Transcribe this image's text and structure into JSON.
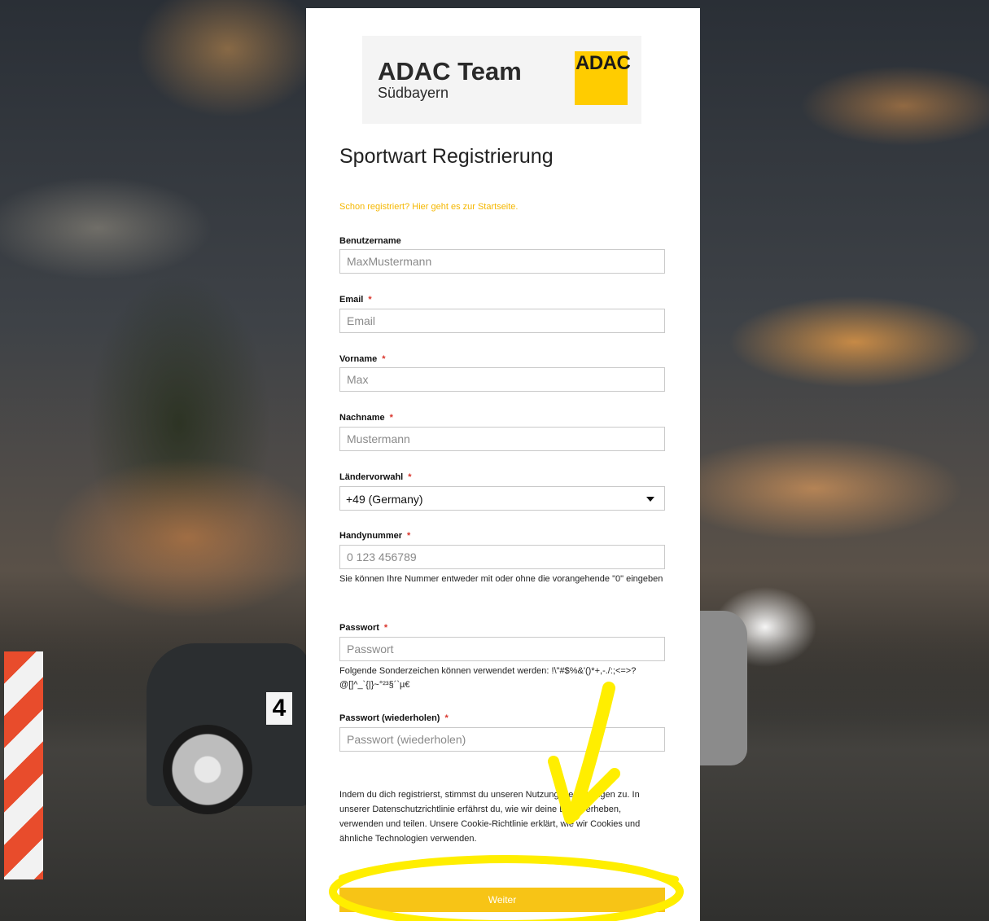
{
  "brand": {
    "title": "ADAC Team",
    "subtitle": "Südbayern",
    "logo_text": "ADAC"
  },
  "page_title": "Sportwart Registrierung",
  "login_link": "Schon registriert? Hier geht es zur Startseite.",
  "required_marker": "*",
  "fields": {
    "username": {
      "label": "Benutzername",
      "placeholder": "MaxMustermann"
    },
    "email": {
      "label": "Email",
      "placeholder": "Email"
    },
    "firstname": {
      "label": "Vorname",
      "placeholder": "Max"
    },
    "lastname": {
      "label": "Nachname",
      "placeholder": "Mustermann"
    },
    "country_code": {
      "label": "Ländervorwahl",
      "value": "+49 (Germany)"
    },
    "phone": {
      "label": "Handynummer",
      "placeholder": "0 123 456789",
      "hint": "Sie können Ihre Nummer entweder mit oder ohne die vorangehende \"0\" eingeben"
    },
    "password": {
      "label": "Passwort",
      "placeholder": "Passwort",
      "hint": "Folgende Sonderzeichen können verwendet werden: !\\\"#$%&'()*+,-./:;<=>?@[]^_`{|}~°²³§´`µ€"
    },
    "password_repeat": {
      "label": "Passwort (wiederholen)",
      "placeholder": "Passwort (wiederholen)"
    }
  },
  "terms_text": "Indem du dich registrierst, stimmst du unseren Nutzungsbedingungen zu. In unserer Datenschutzrichtlinie erfährst du, wie wir deine Daten erheben, verwenden und teilen. Unsere Cookie-Richtlinie erklärt, wie wir Cookies und ähnliche Technologien verwenden.",
  "submit_label": "Weiter",
  "colors": {
    "accent": "#f7c416",
    "link": "#f5b700",
    "required": "#d9342b",
    "annotation": "#ffee00"
  },
  "background_overlay": {
    "car_number": "4"
  }
}
